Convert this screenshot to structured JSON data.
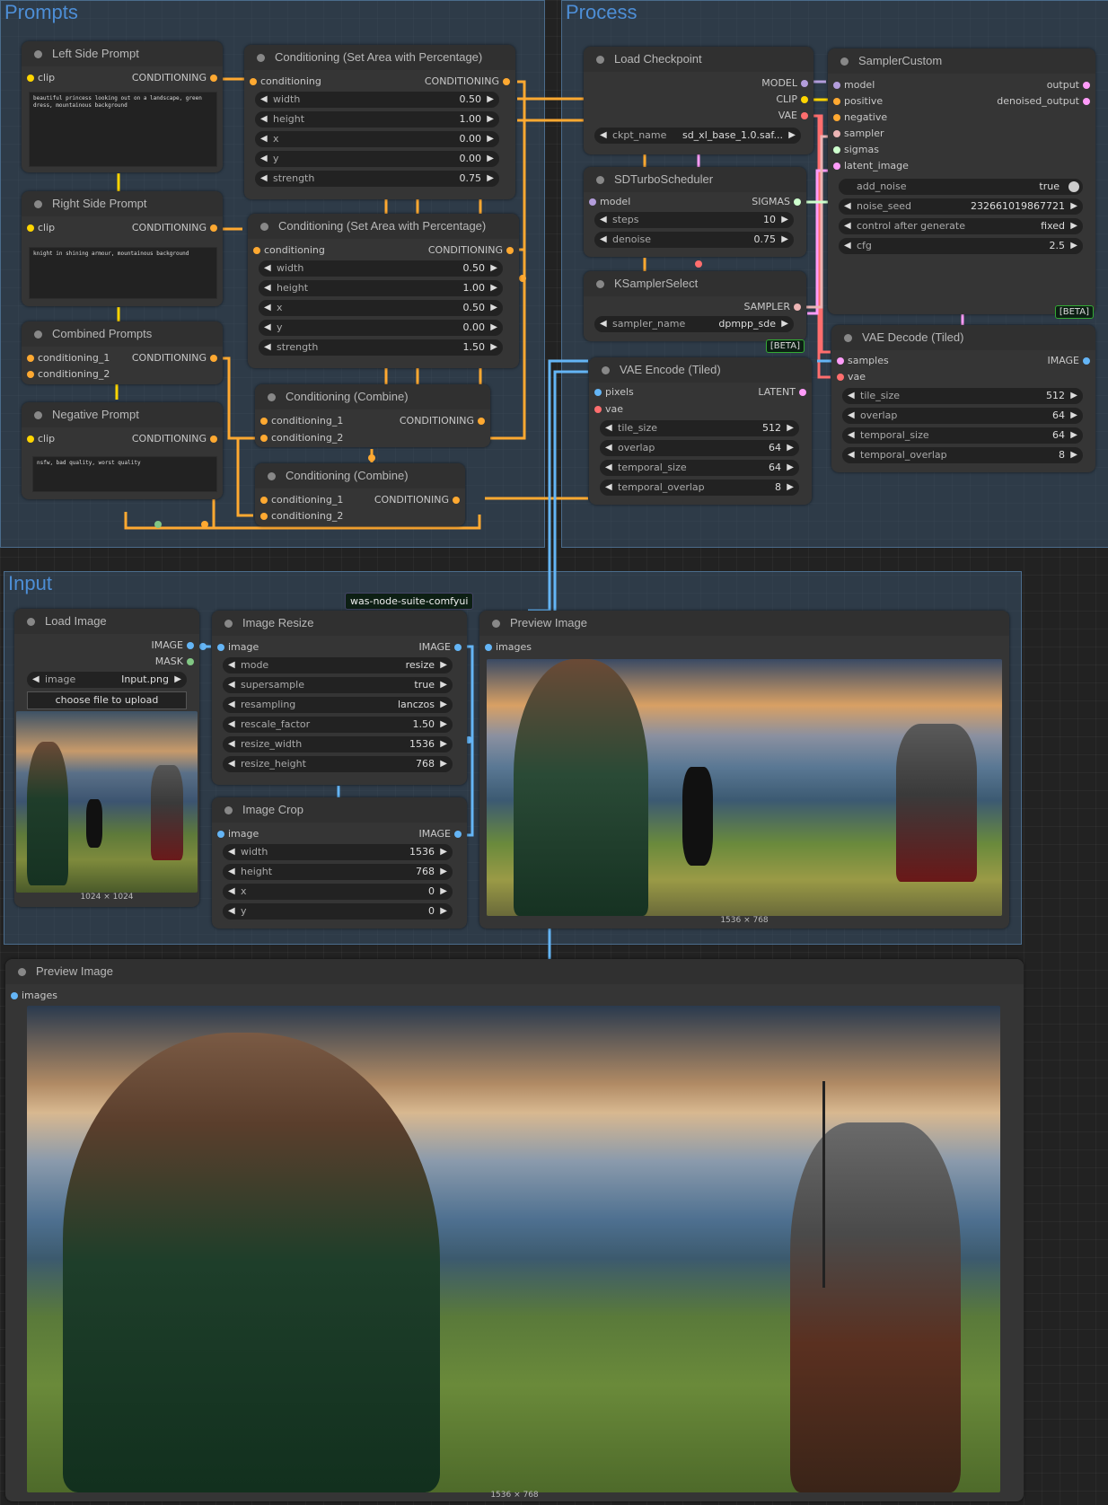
{
  "colors": {
    "conditioning": "#ffa931",
    "clip": "#ffd500",
    "model": "#b39ddb",
    "vae": "#ff6e6e",
    "latent": "#ff9cf9",
    "image": "#64b5f6",
    "sigmas": "#cdffcd",
    "sampler": "#ecb4b4",
    "mask": "#81c784",
    "group_title": "#4d8ed6"
  },
  "groups": {
    "prompts": "Prompts",
    "process": "Process",
    "input": "Input"
  },
  "nodes": {
    "left_prompt": {
      "title": "Left Side Prompt",
      "in": "clip",
      "out": "CONDITIONING",
      "text": "beautiful princess looking out on a landscape, green dress, mountainous background"
    },
    "right_prompt": {
      "title": "Right Side Prompt",
      "in": "clip",
      "out": "CONDITIONING",
      "text": "knight in shining armour, mountainous background"
    },
    "combined": {
      "title": "Combined Prompts",
      "in1": "conditioning_1",
      "in2": "conditioning_2",
      "out": "CONDITIONING"
    },
    "negative": {
      "title": "Negative Prompt",
      "in": "clip",
      "out": "CONDITIONING",
      "text": "nsfw, bad quality, worst quality"
    },
    "cond_area1": {
      "title": "Conditioning (Set Area with Percentage)",
      "in": "conditioning",
      "out": "CONDITIONING",
      "widgets": [
        {
          "l": "width",
          "v": "0.50"
        },
        {
          "l": "height",
          "v": "1.00"
        },
        {
          "l": "x",
          "v": "0.00"
        },
        {
          "l": "y",
          "v": "0.00"
        },
        {
          "l": "strength",
          "v": "0.75"
        }
      ]
    },
    "cond_area2": {
      "title": "Conditioning (Set Area with Percentage)",
      "in": "conditioning",
      "out": "CONDITIONING",
      "widgets": [
        {
          "l": "width",
          "v": "0.50"
        },
        {
          "l": "height",
          "v": "1.00"
        },
        {
          "l": "x",
          "v": "0.50"
        },
        {
          "l": "y",
          "v": "0.00"
        },
        {
          "l": "strength",
          "v": "1.50"
        }
      ]
    },
    "combine1": {
      "title": "Conditioning (Combine)",
      "in1": "conditioning_1",
      "in2": "conditioning_2",
      "out": "CONDITIONING"
    },
    "combine2": {
      "title": "Conditioning (Combine)",
      "in1": "conditioning_1",
      "in2": "conditioning_2",
      "out": "CONDITIONING"
    },
    "checkpoint": {
      "title": "Load Checkpoint",
      "out1": "MODEL",
      "out2": "CLIP",
      "out3": "VAE",
      "w_l": "ckpt_name",
      "w_v": "sd_xl_base_1.0.saf..."
    },
    "turbo": {
      "title": "SDTurboScheduler",
      "in": "model",
      "out": "SIGMAS",
      "widgets": [
        {
          "l": "steps",
          "v": "10"
        },
        {
          "l": "denoise",
          "v": "0.75"
        }
      ]
    },
    "ksel": {
      "title": "KSamplerSelect",
      "out": "SAMPLER",
      "w_l": "sampler_name",
      "w_v": "dpmpp_sde",
      "badge": "[BETA]"
    },
    "sampler": {
      "title": "SamplerCustom",
      "inputs": [
        "model",
        "positive",
        "negative",
        "sampler",
        "sigmas",
        "latent_image"
      ],
      "out1": "output",
      "out2": "denoised_output",
      "widgets": [
        {
          "l": "add_noise",
          "v": "true"
        },
        {
          "l": "noise_seed",
          "v": "232661019867721"
        },
        {
          "l": "control after generate",
          "v": "fixed"
        },
        {
          "l": "cfg",
          "v": "2.5"
        }
      ],
      "badge": "[BETA]"
    },
    "vae_encode": {
      "title": "VAE Encode (Tiled)",
      "in1": "pixels",
      "in2": "vae",
      "out": "LATENT",
      "widgets": [
        {
          "l": "tile_size",
          "v": "512"
        },
        {
          "l": "overlap",
          "v": "64"
        },
        {
          "l": "temporal_size",
          "v": "64"
        },
        {
          "l": "temporal_overlap",
          "v": "8"
        }
      ]
    },
    "vae_decode": {
      "title": "VAE Decode (Tiled)",
      "in1": "samples",
      "in2": "vae",
      "out": "IMAGE",
      "widgets": [
        {
          "l": "tile_size",
          "v": "512"
        },
        {
          "l": "overlap",
          "v": "64"
        },
        {
          "l": "temporal_size",
          "v": "64"
        },
        {
          "l": "temporal_overlap",
          "v": "8"
        }
      ]
    },
    "load_image": {
      "title": "Load Image",
      "out1": "IMAGE",
      "out2": "MASK",
      "w_l": "image",
      "w_v": "Input.png",
      "upload": "choose file to upload",
      "size": "1024 × 1024"
    },
    "resize": {
      "title": "Image Resize",
      "in": "image",
      "out": "IMAGE",
      "widgets": [
        {
          "l": "mode",
          "v": "resize"
        },
        {
          "l": "supersample",
          "v": "true"
        },
        {
          "l": "resampling",
          "v": "lanczos"
        },
        {
          "l": "rescale_factor",
          "v": "1.50"
        },
        {
          "l": "resize_width",
          "v": "1536"
        },
        {
          "l": "resize_height",
          "v": "768"
        }
      ]
    },
    "crop": {
      "title": "Image Crop",
      "in": "image",
      "out": "IMAGE",
      "widgets": [
        {
          "l": "width",
          "v": "1536"
        },
        {
          "l": "height",
          "v": "768"
        },
        {
          "l": "x",
          "v": "0"
        },
        {
          "l": "y",
          "v": "0"
        }
      ]
    },
    "preview1": {
      "title": "Preview Image",
      "in": "images",
      "size": "1536 × 768"
    },
    "preview2": {
      "title": "Preview Image",
      "in": "images",
      "size": "1536 × 768"
    }
  },
  "tooltip": "was-node-suite-comfyui"
}
